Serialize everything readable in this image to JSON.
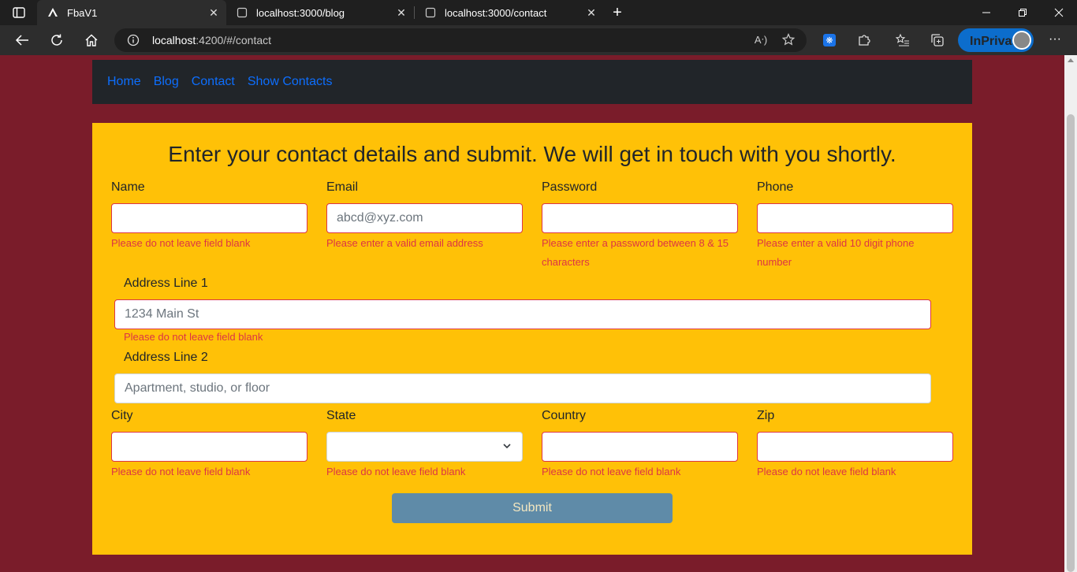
{
  "browser": {
    "tabs": [
      {
        "title": "FbaV1",
        "active": true
      },
      {
        "title": "localhost:3000/blog",
        "active": false
      },
      {
        "title": "localhost:3000/contact",
        "active": false
      }
    ],
    "url_host": "localhost",
    "url_path": ":4200/#/contact",
    "inprivate_label": "InPrivate"
  },
  "nav": {
    "links": [
      "Home",
      "Blog",
      "Contact",
      "Show Contacts"
    ]
  },
  "form": {
    "heading": "Enter your contact details and submit. We will get in touch with you shortly.",
    "name": {
      "label": "Name",
      "value": "",
      "error": "Please do not leave field blank"
    },
    "email": {
      "label": "Email",
      "placeholder": "abcd@xyz.com",
      "error": "Please enter a valid email address"
    },
    "password": {
      "label": "Password",
      "value": "",
      "error_line1": "Please enter a password between 8 & 15",
      "error_line2": "characters"
    },
    "phone": {
      "label": "Phone",
      "value": "",
      "error_line1": "Please enter a valid 10 digit phone",
      "error_line2": "number"
    },
    "address1": {
      "label": "Address Line 1",
      "placeholder": "1234 Main St",
      "error": "Please do not leave field blank"
    },
    "address2": {
      "label": "Address Line 2",
      "placeholder": "Apartment, studio, or floor"
    },
    "city": {
      "label": "City",
      "value": "",
      "error": "Please do not leave field blank"
    },
    "state": {
      "label": "State",
      "value": "",
      "error": "Please do not leave field blank"
    },
    "country": {
      "label": "Country",
      "value": "",
      "error": "Please do not leave field blank"
    },
    "zip": {
      "label": "Zip",
      "value": "",
      "error": "Please do not leave field blank"
    },
    "submit_label": "Submit"
  }
}
